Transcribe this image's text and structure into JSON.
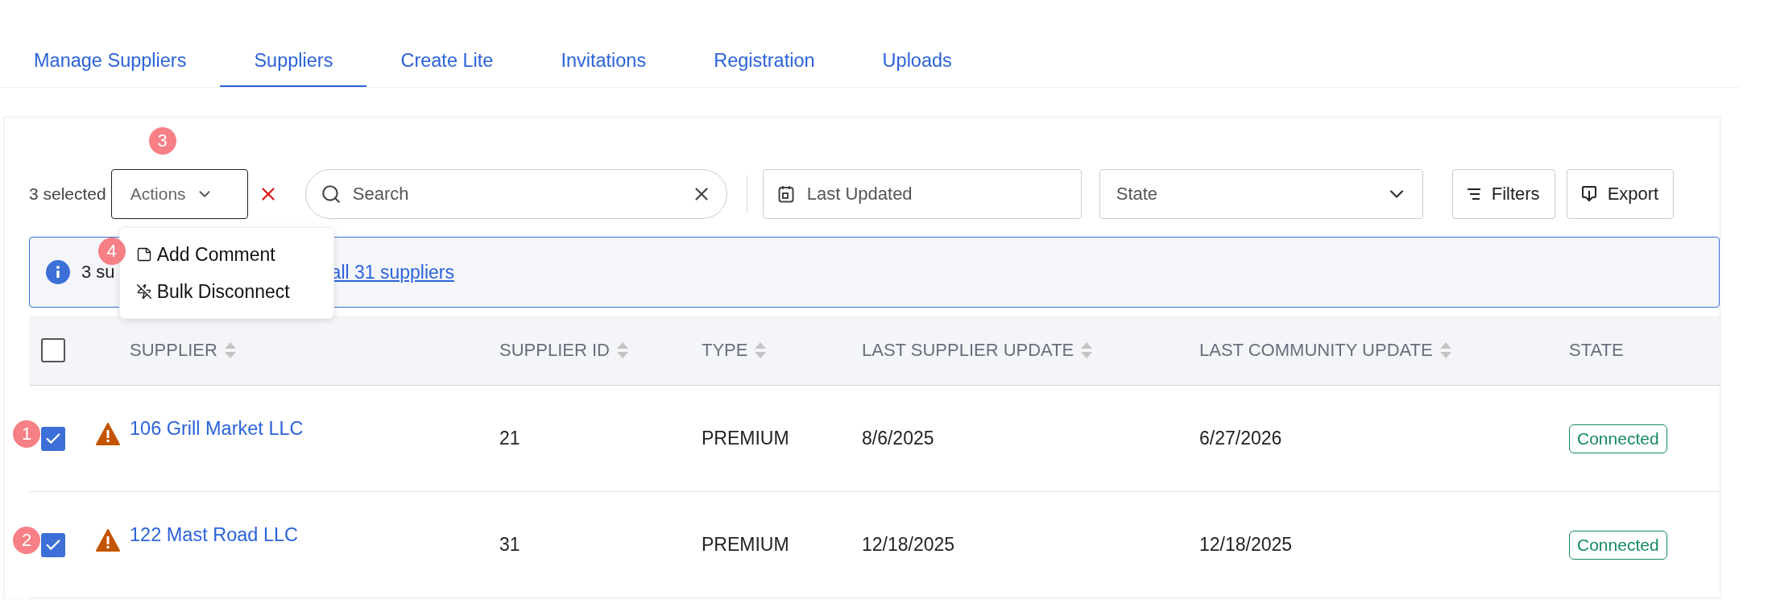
{
  "tabs": [
    {
      "label": "Manage Suppliers",
      "selected": false
    },
    {
      "label": "Suppliers",
      "selected": true
    },
    {
      "label": "Create Lite",
      "selected": false
    },
    {
      "label": "Invitations",
      "selected": false
    },
    {
      "label": "Registration",
      "selected": false
    },
    {
      "label": "Uploads",
      "selected": false
    }
  ],
  "toolbar": {
    "selected_count": "3 selected",
    "actions_label": "Actions",
    "actions_badge": "3",
    "search": {
      "placeholder": "Search"
    },
    "date_filter": {
      "placeholder": "Last Updated"
    },
    "state_filter": {
      "placeholder": "State"
    },
    "filters_button": "Filters",
    "export_button": "Export"
  },
  "actions_menu": {
    "badge": "4",
    "items": [
      {
        "kind": "comment",
        "label": "Add Comment"
      },
      {
        "kind": "disconnect",
        "label": "Bulk Disconnect"
      }
    ]
  },
  "info_bar": {
    "text": "3 su",
    "link": "all 31 suppliers"
  },
  "table": {
    "select_all_checked": false,
    "columns": [
      {
        "label": "SUPPLIER",
        "sortable": true
      },
      {
        "label": "SUPPLIER ID",
        "sortable": true
      },
      {
        "label": "TYPE",
        "sortable": true
      },
      {
        "label": "LAST SUPPLIER UPDATE",
        "sortable": true
      },
      {
        "label": "LAST COMMUNITY UPDATE",
        "sortable": true
      },
      {
        "label": "STATE",
        "sortable": false
      }
    ],
    "rows": [
      {
        "badge": "1",
        "checked": true,
        "warning": true,
        "supplier": "106 Grill Market LLC",
        "supplier_id": "21",
        "type": "PREMIUM",
        "last_supplier_update": "8/6/2025",
        "last_community_update": "6/27/2026",
        "state": "Connected"
      },
      {
        "badge": "2",
        "checked": true,
        "warning": true,
        "supplier": "122 Mast Road LLC",
        "supplier_id": "31",
        "type": "PREMIUM",
        "last_supplier_update": "12/18/2025",
        "last_community_update": "12/18/2025",
        "state": "Connected"
      }
    ]
  }
}
